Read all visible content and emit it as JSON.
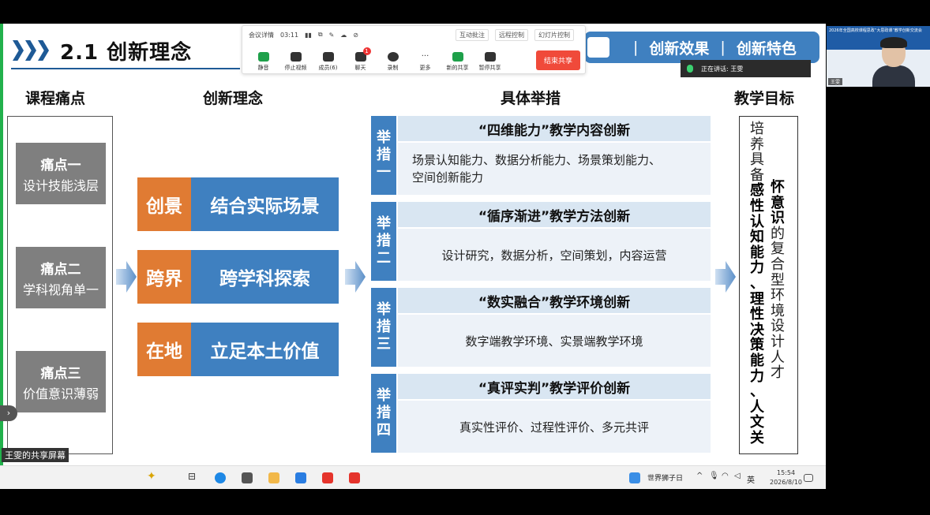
{
  "slide": {
    "title": "2.1 创新理念",
    "nav_items": [
      "创新效果",
      "创新特色"
    ],
    "nav_sep": "|"
  },
  "meeting": {
    "top": {
      "details": "会议详情",
      "time": "03:11",
      "interaction": "互动批注",
      "remote": "远程控制",
      "slideshow": "幻灯片控制"
    },
    "buttons": [
      {
        "label": "静音"
      },
      {
        "label": "停止视频"
      },
      {
        "label": "成员(6)"
      },
      {
        "label": "聊天",
        "badge": "1"
      },
      {
        "label": "录制"
      },
      {
        "label": "更多"
      },
      {
        "label": "新的共享"
      },
      {
        "label": "暂停共享"
      }
    ],
    "end_share": "结束共享",
    "speaker": "正在讲话:  王雯"
  },
  "columns": {
    "pain": "课程痛点",
    "concept": "创新理念",
    "measure": "具体举措",
    "goal": "教学目标"
  },
  "pains": [
    {
      "title": "痛点一",
      "desc": "设计技能浅层"
    },
    {
      "title": "痛点二",
      "desc": "学科视角单一"
    },
    {
      "title": "痛点三",
      "desc": "价值意识薄弱"
    }
  ],
  "concepts": [
    {
      "tag": "创景",
      "text": "结合实际场景"
    },
    {
      "tag": "跨界",
      "text": "跨学科探索"
    },
    {
      "tag": "在地",
      "text": "立足本土价值"
    }
  ],
  "measures": [
    {
      "tag": [
        "举",
        "措",
        "一"
      ],
      "head": "“四维能力”教学内容创新",
      "body_lines": [
        "场景认知能力、数据分析能力、场景策划能力、",
        "空间创新能力"
      ]
    },
    {
      "tag": [
        "举",
        "措",
        "二"
      ],
      "head": "“循序渐进”教学方法创新",
      "body_lines": [
        "设计研究，数据分析，空间策划，内容运营"
      ]
    },
    {
      "tag": [
        "举",
        "措",
        "三"
      ],
      "head": "“数实融合”教学环境创新",
      "body_lines": [
        "数字端教学环境、实景端教学环境"
      ]
    },
    {
      "tag": [
        "举",
        "措",
        "四"
      ],
      "head": "“真评实判”教学评价创新",
      "body_lines": [
        "真实性评价、过程性评价、多元共评"
      ]
    }
  ],
  "goal": {
    "col1": [
      "培",
      "养",
      "具",
      "备",
      "感",
      "性",
      "认",
      "知",
      "能",
      "力",
      "、",
      "理",
      "性",
      "决",
      "策",
      "能",
      "力",
      "、",
      "人",
      "文",
      "关"
    ],
    "col1_bold_from": 4,
    "col2": [
      "怀",
      "意",
      "识",
      "的",
      "复",
      "合",
      "型",
      "环",
      "境",
      "设",
      "计",
      "人",
      "才"
    ],
    "col2_bold_until": 3
  },
  "taskbar": {
    "share_label": "王雯的共享屏幕",
    "widget": "世界狮子日",
    "lang": "英",
    "time": "15:54",
    "date": "2026/8/10"
  },
  "video": {
    "name": "王雯",
    "banner": "2026年全国高校课程思政“大思政课”教学创新交流会"
  },
  "colors": {
    "blue": "#3f80c0",
    "orange": "#e07b33",
    "gray": "#7f7f7f",
    "end_red": "#f04a3a"
  }
}
